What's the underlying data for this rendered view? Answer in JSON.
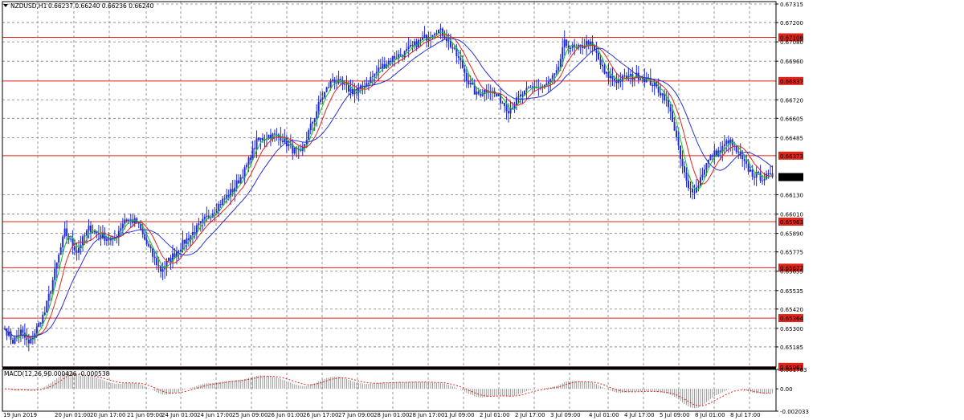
{
  "header": {
    "symbol_label": "NZDUSD,H1",
    "ohlc_text": "0.66237 0.66240 0.66236 0.66240"
  },
  "macd_header": {
    "title": "MACD(12,26,9)",
    "values_text": "-0.000426 -0.000538"
  },
  "colors": {
    "candles": "#1f2bd6",
    "ma_fast": "#11c511",
    "ma_mid": "#e2231a",
    "ma_slow": "#2731d6",
    "level_line": "#e2231a",
    "level_badge": "#e2231a",
    "current_badge": "#000000",
    "macd_signal": "#e2231a",
    "macd_hist": "#9a9a9a",
    "grid": "#7d7d7d"
  },
  "chart_data": {
    "type": "candlestick",
    "symbol": "NZDUSD",
    "timeframe": "H1",
    "price_axis": {
      "range": [
        0.6506,
        0.6733
      ],
      "tick_labels": [
        "0.67315",
        "0.67200",
        "0.67080",
        "0.66960",
        "0.66720",
        "0.66605",
        "0.66485",
        "0.66130",
        "0.66010",
        "0.65890",
        "0.65775",
        "0.65655",
        "0.65535",
        "0.65420",
        "0.65300",
        "0.65185"
      ]
    },
    "x_tick_labels": [
      "19 Jun 2019",
      "20 Jun 01:00",
      "20 Jun 17:00",
      "21 Jun 09:00",
      "24 Jun 01:00",
      "24 Jun 17:00",
      "25 Jun 09:00",
      "26 Jun 01:00",
      "26 Jun 17:00",
      "27 Jun 09:00",
      "28 Jun 01:00",
      "28 Jun 17:00",
      "1 Jul 09:00",
      "2 Jul 01:00",
      "2 Jul 17:00",
      "3 Jul 09:00",
      "4 Jul 01:00",
      "4 Jul 17:00",
      "5 Jul 09:00",
      "8 Jul 01:00",
      "8 Jul 17:00"
    ],
    "horizontal_levels": [
      0.67108,
      0.66837,
      0.66373,
      0.65963,
      0.65677,
      0.65364,
      0.65061
    ],
    "level_labels": [
      "0.67108",
      "0.66837",
      "0.66373",
      "0.65963",
      "0.65677",
      "0.65364",
      "0.65061"
    ],
    "current_price": 0.6624,
    "current_price_label": "0.66240",
    "price_path": [
      [
        0,
        0.653
      ],
      [
        4,
        0.6522
      ],
      [
        8,
        0.6528
      ],
      [
        12,
        0.652
      ],
      [
        16,
        0.653
      ],
      [
        20,
        0.654
      ],
      [
        26,
        0.657
      ],
      [
        30,
        0.659
      ],
      [
        36,
        0.6578
      ],
      [
        42,
        0.6592
      ],
      [
        48,
        0.6588
      ],
      [
        54,
        0.6584
      ],
      [
        60,
        0.6598
      ],
      [
        66,
        0.6596
      ],
      [
        70,
        0.6585
      ],
      [
        74,
        0.6575
      ],
      [
        78,
        0.6566
      ],
      [
        84,
        0.6575
      ],
      [
        90,
        0.6584
      ],
      [
        96,
        0.6592
      ],
      [
        102,
        0.66
      ],
      [
        108,
        0.6608
      ],
      [
        114,
        0.6616
      ],
      [
        120,
        0.6628
      ],
      [
        126,
        0.6646
      ],
      [
        132,
        0.665
      ],
      [
        138,
        0.6649
      ],
      [
        144,
        0.6641
      ],
      [
        148,
        0.6638
      ],
      [
        152,
        0.6652
      ],
      [
        158,
        0.6672
      ],
      [
        164,
        0.6685
      ],
      [
        170,
        0.668
      ],
      [
        176,
        0.6676
      ],
      [
        182,
        0.6684
      ],
      [
        188,
        0.6692
      ],
      [
        194,
        0.6698
      ],
      [
        200,
        0.6701
      ],
      [
        206,
        0.6707
      ],
      [
        212,
        0.6712
      ],
      [
        216,
        0.6716
      ],
      [
        220,
        0.6712
      ],
      [
        224,
        0.6704
      ],
      [
        228,
        0.6695
      ],
      [
        232,
        0.6683
      ],
      [
        236,
        0.6675
      ],
      [
        242,
        0.6679
      ],
      [
        248,
        0.6672
      ],
      [
        252,
        0.6666
      ],
      [
        258,
        0.6674
      ],
      [
        264,
        0.668
      ],
      [
        270,
        0.668
      ],
      [
        276,
        0.6688
      ],
      [
        280,
        0.6707
      ],
      [
        286,
        0.6703
      ],
      [
        292,
        0.6708
      ],
      [
        296,
        0.67
      ],
      [
        300,
        0.6688
      ],
      [
        306,
        0.6684
      ],
      [
        312,
        0.6686
      ],
      [
        318,
        0.6687
      ],
      [
        324,
        0.6682
      ],
      [
        330,
        0.6674
      ],
      [
        334,
        0.666
      ],
      [
        338,
        0.6635
      ],
      [
        342,
        0.6616
      ],
      [
        346,
        0.6617
      ],
      [
        350,
        0.663
      ],
      [
        354,
        0.6638
      ],
      [
        358,
        0.664
      ],
      [
        362,
        0.6647
      ],
      [
        366,
        0.664
      ],
      [
        370,
        0.6632
      ],
      [
        374,
        0.6626
      ],
      [
        378,
        0.6624
      ],
      [
        382,
        0.6624
      ],
      [
        384,
        0.6624
      ]
    ],
    "moving_averages": [
      {
        "period": 5,
        "color": "green"
      },
      {
        "period": 10,
        "color": "red"
      },
      {
        "period": 21,
        "color": "blue"
      }
    ],
    "macd": {
      "title": "MACD(12,26,9)",
      "main": -0.000426,
      "signal": -0.000538,
      "axis_labels": [
        "0.001763",
        "0.00",
        "-0.002033"
      ]
    }
  }
}
